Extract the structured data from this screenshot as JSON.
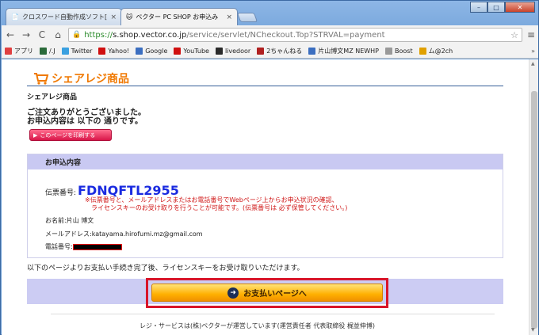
{
  "tabs": [
    {
      "label": "クロスワード自動作成ソフト[ク",
      "close": "×"
    },
    {
      "label": "ベクター PC SHOP お申込み",
      "close": "×"
    }
  ],
  "window_buttons": {
    "minimize": "–",
    "maximize": "□",
    "close": "✕"
  },
  "toolbar": {
    "back": "←",
    "forward": "→",
    "reload": "C",
    "home": "⌂",
    "url_scheme": "https://",
    "url_host": "s.shop.vector.co.jp",
    "url_path": "/service/servlet/NCheckout.Top?STRVAL=payment",
    "star": "☆",
    "menu": "≡"
  },
  "bookmarks": [
    {
      "label": "アプリ",
      "color": "#e04040"
    },
    {
      "label": "/.J",
      "color": "#2a6a3a"
    },
    {
      "label": "Twitter",
      "color": "#3aa0e0"
    },
    {
      "label": "Yahoo!",
      "color": "#d01010"
    },
    {
      "label": "Google",
      "color": "#3b6ec0"
    },
    {
      "label": "YouTube",
      "color": "#d01010"
    },
    {
      "label": "livedoor",
      "color": "#2a2a2a"
    },
    {
      "label": "2ちゃんねる",
      "color": "#b02020"
    },
    {
      "label": "片山博文MZ NEWHP",
      "color": "#3b6ec0"
    },
    {
      "label": "Boost",
      "color": "#999999"
    },
    {
      "label": "ム@2ch",
      "color": "#e0a000"
    }
  ],
  "bookmarks_more": "»",
  "page": {
    "brand": "シェアレジ商品",
    "subhead": "シェアレジ商品",
    "thanks_line1": "ご注文ありがとうございました。",
    "thanks_line2": "お申込内容は 以下の 通りです。",
    "print_button": "このページを印刷する",
    "order_header": "お申込内容",
    "order_id_label": "伝票番号:",
    "order_id": "FDNQFTL2955",
    "note_line1": "※伝票番号と、メールアドレスまたはお電話番号でWebページ上からお申込状況の確認、",
    "note_line2": "ライセンスキーのお受け取りを行うことが可能です。(伝票番号は 必ず保管してください。)",
    "name_label": "お名前:",
    "name_value": "片山 博文",
    "email_label": "メールアドレス:",
    "email_value": "katayama.hirofumi.mz@gmail.com",
    "phone_label": "電話番号:",
    "instruction": "以下のページよりお支払い手続き完了後、ライセンスキーをお受け取りいただけます。",
    "pay_button": "お支払いページへ",
    "footer": "レジ・サービスは(株)ベクターが運営しています(運営責任者 代表取締役 梶並伸博)"
  },
  "colors": {
    "brand": "#f07800",
    "order_id": "#1a2be0",
    "note": "#d01818",
    "highlight_box": "#d8152a"
  }
}
